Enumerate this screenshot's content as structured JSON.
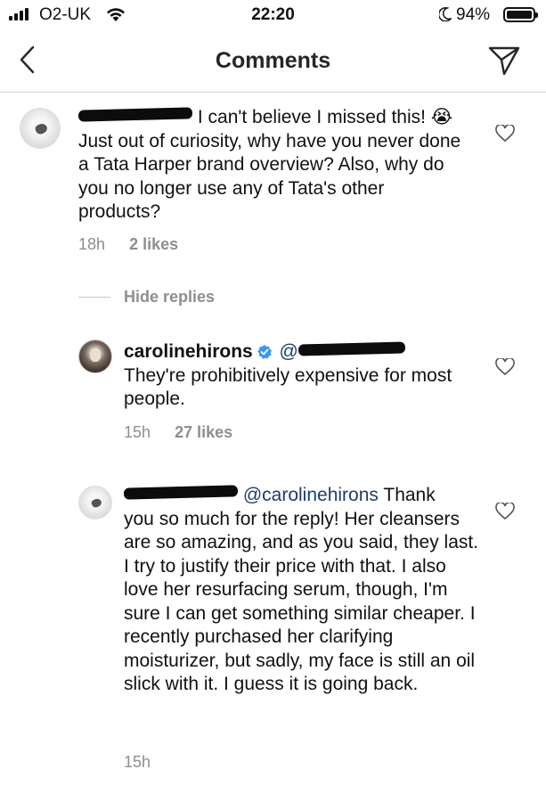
{
  "status_bar": {
    "carrier": "O2-UK",
    "time": "22:20",
    "battery": "94%"
  },
  "nav": {
    "title": "Comments",
    "back_icon": "chevron-left-icon",
    "send_icon": "paper-plane-icon"
  },
  "comments": [
    {
      "text": "I can't believe I missed this! 😭 Just out of curiosity, why have you never done a Tata Harper brand overview? Also, why do you no longer use any of Tata's other products?",
      "time": "18h",
      "likes": "2 likes"
    }
  ],
  "hide_replies": "Hide replies",
  "replies": [
    {
      "username": "carolinehirons",
      "mention": "@",
      "text": "They're prohibitively expensive for most people.",
      "time": "15h",
      "likes": "27 likes"
    },
    {
      "mention": "@carolinehirons",
      "text_line1": "Thank",
      "text": "you so much for the reply! Her cleansers are so amazing, and as you said, they last. I try to justify their price with that. I also love her resurfacing serum, though, I'm sure I can get something similar cheaper. I recently purchased her clarifying moisturizer, but sadly, my face is still an oil slick with it. I guess it is going back.",
      "time": "15h"
    }
  ],
  "colors": {
    "meta_gray": "#8e8e8e",
    "mention_blue": "#1f3c6e",
    "verified_blue": "#3897f0"
  }
}
